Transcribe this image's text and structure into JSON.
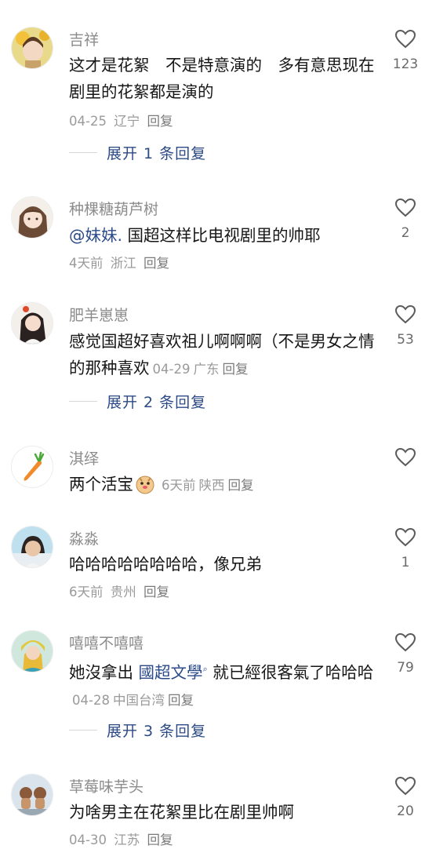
{
  "comments": [
    {
      "user": "吉祥",
      "text_parts": [
        "这才是花絮　不是特意演的　多有意思现在剧里的花絮都是演的"
      ],
      "date": "04-25",
      "location": "辽宁",
      "reply": "回复",
      "likes": "123",
      "expand": "展开 1 条回复"
    },
    {
      "user": "种棵糖葫芦树",
      "mention": "@妹妹.",
      "text_after": " 国超这样比电视剧里的帅耶",
      "date": "4天前",
      "location": "浙江",
      "reply": "回复",
      "likes": "2"
    },
    {
      "user": "肥羊崽崽",
      "text": "感觉国超好喜欢祖儿啊啊啊（不是男女之情的那种喜欢",
      "date": "04-29",
      "location": "广东",
      "reply": "回复",
      "likes": "53",
      "expand": "展开 2 条回复"
    },
    {
      "user": "淇绎",
      "text": "两个活宝",
      "date": "6天前",
      "location": "陕西",
      "reply": "回复",
      "likes": ""
    },
    {
      "user": "淼淼",
      "text": "哈哈哈哈哈哈哈哈，像兄弟",
      "date": "6天前",
      "location": "贵州",
      "reply": "回复",
      "likes": "1"
    },
    {
      "user": "嘻嘻不嘻嘻",
      "text_before": "她沒拿出 ",
      "mention": "國超文學",
      "text_after": " 就已經很客氣了哈哈哈",
      "date": "04-28",
      "location": "中国台湾",
      "reply": "回复",
      "likes": "79",
      "expand": "展开 3 条回复"
    },
    {
      "user": "草莓味芋头",
      "text": "为啥男主在花絮里比在剧里帅啊",
      "date": "04-30",
      "location": "江苏",
      "reply": "回复",
      "likes": "20"
    }
  ],
  "colors": {
    "link": "#2c4a86",
    "meta": "#9a9a9a",
    "username": "#8c8c8c"
  },
  "icons": {
    "like": "heart-outline-icon",
    "emoji": "meerkat-face-emoji-icon",
    "search": "search-mark-icon"
  }
}
